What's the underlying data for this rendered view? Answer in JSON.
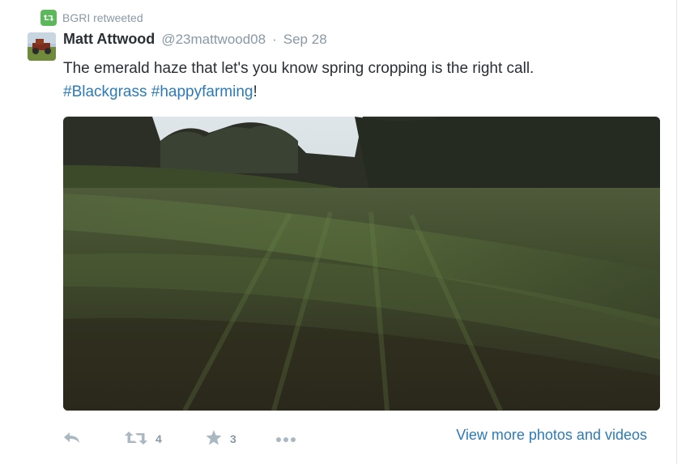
{
  "retweet_context": {
    "label": "BGRI retweeted",
    "icon": "retweet-icon"
  },
  "tweet": {
    "fullname": "Matt Attwood",
    "username": "@23mattwood08",
    "separator": "·",
    "time": "Sep 28",
    "text_line1": "The emerald haze that let's you know spring cropping is the right call.",
    "hashtag1": "#Blackgrass",
    "space": " ",
    "hashtag2": "#happyfarming",
    "trailing": "!"
  },
  "actions": {
    "reply_icon": "reply-icon",
    "retweet_icon": "retweet-icon",
    "retweet_count": "4",
    "favorite_icon": "star-icon",
    "favorite_count": "3",
    "more_icon": "more-icon"
  },
  "more_link": "View more photos and videos",
  "colors": {
    "link": "#2b7bb9",
    "muted": "#8899a6",
    "retweet_badge": "#5db85c",
    "action_icon": "#aab8c2"
  }
}
